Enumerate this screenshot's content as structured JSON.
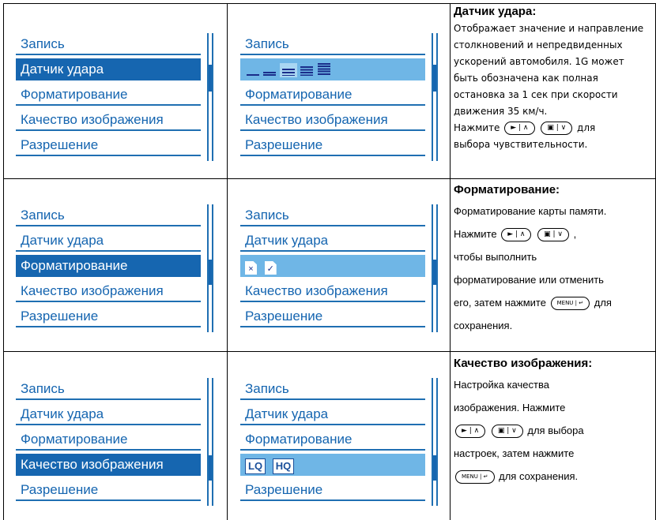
{
  "menu_items": [
    "Запись",
    "Датчик удара",
    "Форматирование",
    "Качество изображения",
    "Разрешение"
  ],
  "format_options": {
    "cancel": "×",
    "confirm": "✓"
  },
  "quality_options": {
    "lq": "LQ",
    "hq": "HQ"
  },
  "sections": [
    {
      "title": "Датчик удара:",
      "lines": [
        "Отображает значение и направление",
        "столкновений и непредвиденных",
        "ускорений автомобиля. 1G может",
        "быть обозначена как полная",
        "остановка за 1 сек при скорости",
        "движения 35 км/ч."
      ],
      "press": "Нажмите",
      "key1": "► | ∧",
      "key2": "▣ | ∨",
      "tail1": "для",
      "tail2": "выбора чувствительности."
    },
    {
      "title": "Форматирование:",
      "line1": "Форматирование карты памяти.",
      "press": "Нажмите",
      "key1": "► | ∧",
      "key2": "▣ | ∨",
      "comma": ",",
      "line3": "чтобы выполнить",
      "line4": "форматирование или отменить",
      "line5a": "его, затем нажмите",
      "key3": "MENU | ↵",
      "line5b": "для",
      "line6": "сохранения."
    },
    {
      "title": "Качество изображения:",
      "line1": "Настройка качества",
      "line2": "изображения. Нажмите",
      "key1": "► | ∧",
      "key2": "▣ | ∨",
      "line3b": "для выбора",
      "line4": "настроек, затем нажмите",
      "key3": "MENU | ↵",
      "line5b": "для сохранения."
    }
  ]
}
